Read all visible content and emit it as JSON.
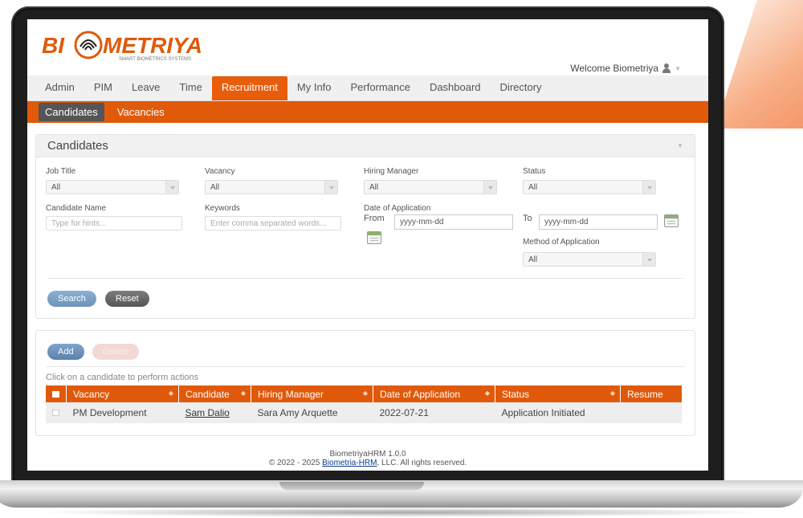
{
  "brand": {
    "name": "BI METRIYA",
    "tagline": "SMART BIOMETRICS SYSTEMS"
  },
  "header": {
    "welcome": "Welcome Biometriya"
  },
  "menu": [
    {
      "label": "Admin"
    },
    {
      "label": "PIM"
    },
    {
      "label": "Leave"
    },
    {
      "label": "Time"
    },
    {
      "label": "Recruitment",
      "active": true
    },
    {
      "label": "My Info"
    },
    {
      "label": "Performance"
    },
    {
      "label": "Dashboard"
    },
    {
      "label": "Directory"
    }
  ],
  "submenu": [
    {
      "label": "Candidates",
      "active": true
    },
    {
      "label": "Vacancies"
    }
  ],
  "search_panel": {
    "title": "Candidates",
    "job_title": {
      "label": "Job Title",
      "value": "All"
    },
    "vacancy": {
      "label": "Vacancy",
      "value": "All"
    },
    "hiring_manager": {
      "label": "Hiring Manager",
      "value": "All"
    },
    "status": {
      "label": "Status",
      "value": "All"
    },
    "candidate_name": {
      "label": "Candidate Name",
      "placeholder": "Type for hints..."
    },
    "keywords": {
      "label": "Keywords",
      "placeholder": "Enter comma separated words..."
    },
    "date_of_application": {
      "label": "Date of Application",
      "from_label": "From",
      "from_value": "yyyy-mm-dd",
      "to_label": "To",
      "to_value": "yyyy-mm-dd"
    },
    "method": {
      "label": "Method of Application",
      "value": "All"
    },
    "search_button": "Search",
    "reset_button": "Reset"
  },
  "results": {
    "add_button": "Add",
    "delete_button": "Delete",
    "hint": "Click on a candidate to perform actions",
    "columns": [
      "Vacancy",
      "Candidate",
      "Hiring Manager",
      "Date of Application",
      "Status",
      "Resume"
    ],
    "rows": [
      {
        "vacancy": "PM Development",
        "candidate": "Sam Dalio",
        "hiring_manager": "Sara Amy Arquette",
        "date": "2022-07-21",
        "status": "Application Initiated",
        "resume": ""
      }
    ]
  },
  "footer": {
    "version": "BiometriyaHRM 1.0.0",
    "copyright_prefix": "© 2022 - 2025 ",
    "link": "Biometria-HRM",
    "copyright_suffix": ", LLC. All rights reserved."
  },
  "colors": {
    "accent": "#e05a0a",
    "active_sub": "#555555",
    "search_btn": "#7ea3c8"
  },
  "icons": [
    "user-icon",
    "calendar-icon",
    "dropdown-arrow-icon",
    "sort-icon",
    "collapse-icon",
    "fingerprint-logo-icon"
  ]
}
